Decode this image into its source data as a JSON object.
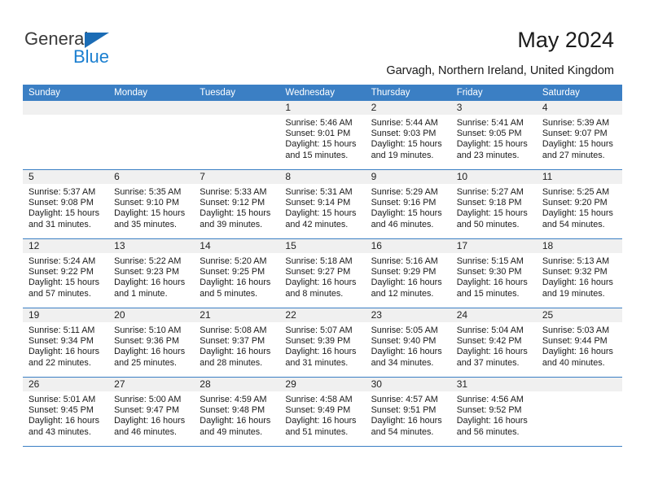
{
  "brand": {
    "name_part1": "General",
    "name_part2": "Blue",
    "accent_color": "#1b7fd0",
    "triangle_color": "#1b6cb5"
  },
  "header": {
    "title": "May 2024",
    "subtitle": "Garvagh, Northern Ireland, United Kingdom"
  },
  "calendar": {
    "header_color": "#3b7fc4",
    "weekday_headers": [
      "Sunday",
      "Monday",
      "Tuesday",
      "Wednesday",
      "Thursday",
      "Friday",
      "Saturday"
    ],
    "weeks": [
      [
        {
          "day": "",
          "sunrise": "",
          "sunset": "",
          "daylight_line1": "",
          "daylight_line2": ""
        },
        {
          "day": "",
          "sunrise": "",
          "sunset": "",
          "daylight_line1": "",
          "daylight_line2": ""
        },
        {
          "day": "",
          "sunrise": "",
          "sunset": "",
          "daylight_line1": "",
          "daylight_line2": ""
        },
        {
          "day": "1",
          "sunrise": "Sunrise: 5:46 AM",
          "sunset": "Sunset: 9:01 PM",
          "daylight_line1": "Daylight: 15 hours",
          "daylight_line2": "and 15 minutes."
        },
        {
          "day": "2",
          "sunrise": "Sunrise: 5:44 AM",
          "sunset": "Sunset: 9:03 PM",
          "daylight_line1": "Daylight: 15 hours",
          "daylight_line2": "and 19 minutes."
        },
        {
          "day": "3",
          "sunrise": "Sunrise: 5:41 AM",
          "sunset": "Sunset: 9:05 PM",
          "daylight_line1": "Daylight: 15 hours",
          "daylight_line2": "and 23 minutes."
        },
        {
          "day": "4",
          "sunrise": "Sunrise: 5:39 AM",
          "sunset": "Sunset: 9:07 PM",
          "daylight_line1": "Daylight: 15 hours",
          "daylight_line2": "and 27 minutes."
        }
      ],
      [
        {
          "day": "5",
          "sunrise": "Sunrise: 5:37 AM",
          "sunset": "Sunset: 9:08 PM",
          "daylight_line1": "Daylight: 15 hours",
          "daylight_line2": "and 31 minutes."
        },
        {
          "day": "6",
          "sunrise": "Sunrise: 5:35 AM",
          "sunset": "Sunset: 9:10 PM",
          "daylight_line1": "Daylight: 15 hours",
          "daylight_line2": "and 35 minutes."
        },
        {
          "day": "7",
          "sunrise": "Sunrise: 5:33 AM",
          "sunset": "Sunset: 9:12 PM",
          "daylight_line1": "Daylight: 15 hours",
          "daylight_line2": "and 39 minutes."
        },
        {
          "day": "8",
          "sunrise": "Sunrise: 5:31 AM",
          "sunset": "Sunset: 9:14 PM",
          "daylight_line1": "Daylight: 15 hours",
          "daylight_line2": "and 42 minutes."
        },
        {
          "day": "9",
          "sunrise": "Sunrise: 5:29 AM",
          "sunset": "Sunset: 9:16 PM",
          "daylight_line1": "Daylight: 15 hours",
          "daylight_line2": "and 46 minutes."
        },
        {
          "day": "10",
          "sunrise": "Sunrise: 5:27 AM",
          "sunset": "Sunset: 9:18 PM",
          "daylight_line1": "Daylight: 15 hours",
          "daylight_line2": "and 50 minutes."
        },
        {
          "day": "11",
          "sunrise": "Sunrise: 5:25 AM",
          "sunset": "Sunset: 9:20 PM",
          "daylight_line1": "Daylight: 15 hours",
          "daylight_line2": "and 54 minutes."
        }
      ],
      [
        {
          "day": "12",
          "sunrise": "Sunrise: 5:24 AM",
          "sunset": "Sunset: 9:22 PM",
          "daylight_line1": "Daylight: 15 hours",
          "daylight_line2": "and 57 minutes."
        },
        {
          "day": "13",
          "sunrise": "Sunrise: 5:22 AM",
          "sunset": "Sunset: 9:23 PM",
          "daylight_line1": "Daylight: 16 hours",
          "daylight_line2": "and 1 minute."
        },
        {
          "day": "14",
          "sunrise": "Sunrise: 5:20 AM",
          "sunset": "Sunset: 9:25 PM",
          "daylight_line1": "Daylight: 16 hours",
          "daylight_line2": "and 5 minutes."
        },
        {
          "day": "15",
          "sunrise": "Sunrise: 5:18 AM",
          "sunset": "Sunset: 9:27 PM",
          "daylight_line1": "Daylight: 16 hours",
          "daylight_line2": "and 8 minutes."
        },
        {
          "day": "16",
          "sunrise": "Sunrise: 5:16 AM",
          "sunset": "Sunset: 9:29 PM",
          "daylight_line1": "Daylight: 16 hours",
          "daylight_line2": "and 12 minutes."
        },
        {
          "day": "17",
          "sunrise": "Sunrise: 5:15 AM",
          "sunset": "Sunset: 9:30 PM",
          "daylight_line1": "Daylight: 16 hours",
          "daylight_line2": "and 15 minutes."
        },
        {
          "day": "18",
          "sunrise": "Sunrise: 5:13 AM",
          "sunset": "Sunset: 9:32 PM",
          "daylight_line1": "Daylight: 16 hours",
          "daylight_line2": "and 19 minutes."
        }
      ],
      [
        {
          "day": "19",
          "sunrise": "Sunrise: 5:11 AM",
          "sunset": "Sunset: 9:34 PM",
          "daylight_line1": "Daylight: 16 hours",
          "daylight_line2": "and 22 minutes."
        },
        {
          "day": "20",
          "sunrise": "Sunrise: 5:10 AM",
          "sunset": "Sunset: 9:36 PM",
          "daylight_line1": "Daylight: 16 hours",
          "daylight_line2": "and 25 minutes."
        },
        {
          "day": "21",
          "sunrise": "Sunrise: 5:08 AM",
          "sunset": "Sunset: 9:37 PM",
          "daylight_line1": "Daylight: 16 hours",
          "daylight_line2": "and 28 minutes."
        },
        {
          "day": "22",
          "sunrise": "Sunrise: 5:07 AM",
          "sunset": "Sunset: 9:39 PM",
          "daylight_line1": "Daylight: 16 hours",
          "daylight_line2": "and 31 minutes."
        },
        {
          "day": "23",
          "sunrise": "Sunrise: 5:05 AM",
          "sunset": "Sunset: 9:40 PM",
          "daylight_line1": "Daylight: 16 hours",
          "daylight_line2": "and 34 minutes."
        },
        {
          "day": "24",
          "sunrise": "Sunrise: 5:04 AM",
          "sunset": "Sunset: 9:42 PM",
          "daylight_line1": "Daylight: 16 hours",
          "daylight_line2": "and 37 minutes."
        },
        {
          "day": "25",
          "sunrise": "Sunrise: 5:03 AM",
          "sunset": "Sunset: 9:44 PM",
          "daylight_line1": "Daylight: 16 hours",
          "daylight_line2": "and 40 minutes."
        }
      ],
      [
        {
          "day": "26",
          "sunrise": "Sunrise: 5:01 AM",
          "sunset": "Sunset: 9:45 PM",
          "daylight_line1": "Daylight: 16 hours",
          "daylight_line2": "and 43 minutes."
        },
        {
          "day": "27",
          "sunrise": "Sunrise: 5:00 AM",
          "sunset": "Sunset: 9:47 PM",
          "daylight_line1": "Daylight: 16 hours",
          "daylight_line2": "and 46 minutes."
        },
        {
          "day": "28",
          "sunrise": "Sunrise: 4:59 AM",
          "sunset": "Sunset: 9:48 PM",
          "daylight_line1": "Daylight: 16 hours",
          "daylight_line2": "and 49 minutes."
        },
        {
          "day": "29",
          "sunrise": "Sunrise: 4:58 AM",
          "sunset": "Sunset: 9:49 PM",
          "daylight_line1": "Daylight: 16 hours",
          "daylight_line2": "and 51 minutes."
        },
        {
          "day": "30",
          "sunrise": "Sunrise: 4:57 AM",
          "sunset": "Sunset: 9:51 PM",
          "daylight_line1": "Daylight: 16 hours",
          "daylight_line2": "and 54 minutes."
        },
        {
          "day": "31",
          "sunrise": "Sunrise: 4:56 AM",
          "sunset": "Sunset: 9:52 PM",
          "daylight_line1": "Daylight: 16 hours",
          "daylight_line2": "and 56 minutes."
        },
        {
          "day": "",
          "sunrise": "",
          "sunset": "",
          "daylight_line1": "",
          "daylight_line2": ""
        }
      ]
    ]
  }
}
